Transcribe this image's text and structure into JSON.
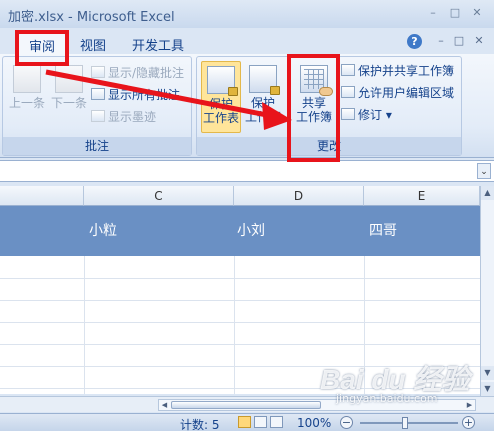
{
  "window": {
    "title": "加密.xlsx - Microsoft Excel",
    "controls": [
      "–",
      "□",
      "✕"
    ]
  },
  "tabs": [
    {
      "label": "审阅",
      "active": true
    },
    {
      "label": "视图",
      "active": false
    },
    {
      "label": "开发工具",
      "active": false
    }
  ],
  "help_glyph": "?",
  "mini_controls": [
    "–",
    "□",
    "✕"
  ],
  "ribbon": {
    "comment_group": {
      "label": "批注",
      "prev_label": "上一条",
      "next_label": "下一条",
      "show_hide_label": "显示/隐藏批注",
      "show_all_label": "显示所有批注",
      "show_ink_label": "显示墨迹"
    },
    "changes_group": {
      "label": "更改",
      "protect_sheet": [
        "保护",
        "工作表"
      ],
      "protect_workbook": [
        "保护",
        "工作簿"
      ],
      "share_workbook": [
        "共享",
        "工作簿"
      ],
      "protect_share_label": "保护并共享工作簿",
      "allow_edit_label": "允许用户编辑区域",
      "track_changes_label": "修订"
    }
  },
  "sheet": {
    "columns": [
      "C",
      "D",
      "E"
    ],
    "header_cells": [
      "小粒",
      "小刘",
      "四哥"
    ]
  },
  "status": {
    "count_label": "计数: 5",
    "zoom_level": "100%",
    "zoom_out": "−",
    "zoom_in": "+"
  },
  "watermark": {
    "brand": "Bai du 经验",
    "url": "jingyan.baidu.com"
  },
  "colors": {
    "annotation_red": "#e8141b",
    "header_fill": "#6a90c4"
  }
}
